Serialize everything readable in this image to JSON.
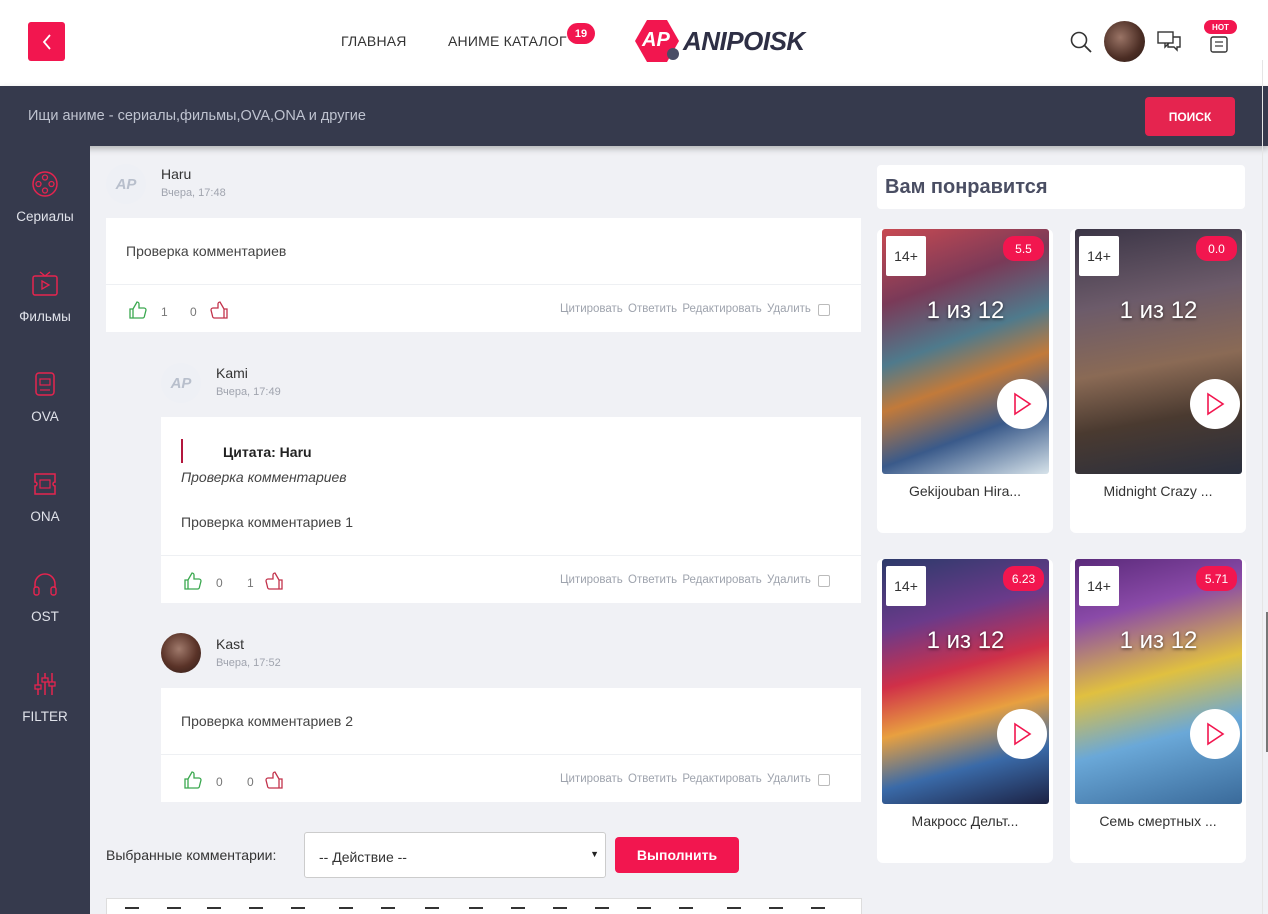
{
  "header": {
    "nav": [
      {
        "label": "ГЛАВНАЯ"
      },
      {
        "label": "АНИМЕ КАТАЛОГ",
        "badge": "19"
      }
    ],
    "logo_text": "ANIPOISK",
    "logo_mark": "AP",
    "hot_badge": "HOT",
    "icons": [
      "back-arrow-icon",
      "search-icon",
      "messages-icon",
      "news-icon"
    ]
  },
  "search": {
    "placeholder": "Ищи аниме - сериалы,фильмы,OVA,ONA и другие",
    "button": "ПОИСК"
  },
  "sidebar": {
    "items": [
      {
        "label": "Сериалы",
        "icon": "film-reel-icon"
      },
      {
        "label": "Фильмы",
        "icon": "tv-play-icon"
      },
      {
        "label": "OVA",
        "icon": "ova-icon"
      },
      {
        "label": "ONA",
        "icon": "ona-icon"
      },
      {
        "label": "OST",
        "icon": "headphones-icon"
      },
      {
        "label": "FILTER",
        "icon": "sliders-icon"
      }
    ]
  },
  "comment_actions": [
    "Цитировать",
    "Ответить",
    "Редактировать",
    "Удалить"
  ],
  "comments": [
    {
      "author": "Haru",
      "date": "Вчера, 17:48",
      "avatar": "AP",
      "text": "Проверка комментариев",
      "likes": "1",
      "dislikes": "0"
    },
    {
      "author": "Kami",
      "date": "Вчера, 17:49",
      "avatar": "AP",
      "quote_title": "Цитата: Haru",
      "quote_text": "Проверка комментариев",
      "text": "Проверка комментариев 1",
      "likes": "0",
      "dislikes": "1"
    },
    {
      "author": "Kast",
      "date": "Вчера, 17:52",
      "avatar": "",
      "text": "Проверка комментариев 2",
      "likes": "0",
      "dislikes": "0"
    }
  ],
  "bulk": {
    "label": "Выбранные комментарии:",
    "select_value": "-- Действие --",
    "button": "Выполнить"
  },
  "recommend": {
    "title": "Вам понравится",
    "cards": [
      {
        "title": "Gekijouban Hira...",
        "age": "14+",
        "score": "5.5",
        "episodes": "1 из 12"
      },
      {
        "title": "Midnight Crazy ...",
        "age": "14+",
        "score": "0.0",
        "episodes": "1 из 12"
      },
      {
        "title": "Макросс Дельт...",
        "age": "14+",
        "score": "6.23",
        "episodes": "1 из 12"
      },
      {
        "title": "Семь смертных ...",
        "age": "14+",
        "score": "5.71",
        "episodes": "1 из 12"
      }
    ]
  },
  "colors": {
    "accent": "#f2164f",
    "dark": "#363a4d",
    "like": "#3aa84f",
    "dislike": "#c2324b"
  }
}
